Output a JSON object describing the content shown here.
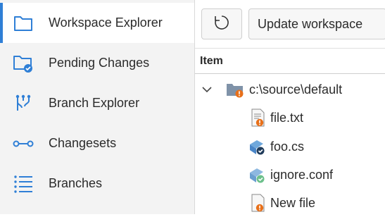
{
  "sidebar": {
    "items": [
      {
        "label": "Workspace Explorer",
        "icon": "folder-icon",
        "active": true
      },
      {
        "label": "Pending Changes",
        "icon": "folder-check-icon"
      },
      {
        "label": "Branch Explorer",
        "icon": "branch-icon"
      },
      {
        "label": "Changesets",
        "icon": "changeset-icon"
      },
      {
        "label": "Branches",
        "icon": "list-icon"
      }
    ]
  },
  "toolbar": {
    "refresh_icon": "refresh-icon",
    "update_label": "Update workspace"
  },
  "table": {
    "header": "Item",
    "rows": [
      {
        "label": "c:\\source\\default",
        "icon": "folder-icon",
        "status": "changed"
      },
      {
        "label": "file.txt",
        "icon": "file-icon",
        "status": "changed"
      },
      {
        "label": "foo.cs",
        "icon": "code-file-icon",
        "status": "checked-in"
      },
      {
        "label": "ignore.conf",
        "icon": "config-file-icon",
        "status": "ignored"
      },
      {
        "label": "New file",
        "icon": "file-icon",
        "status": "changed"
      }
    ]
  },
  "colors": {
    "accent": "#2f7fd6",
    "changed_badge": "#e8701a",
    "checked_badge": "#1f3b5a",
    "ignored_badge": "#6cc08b"
  }
}
